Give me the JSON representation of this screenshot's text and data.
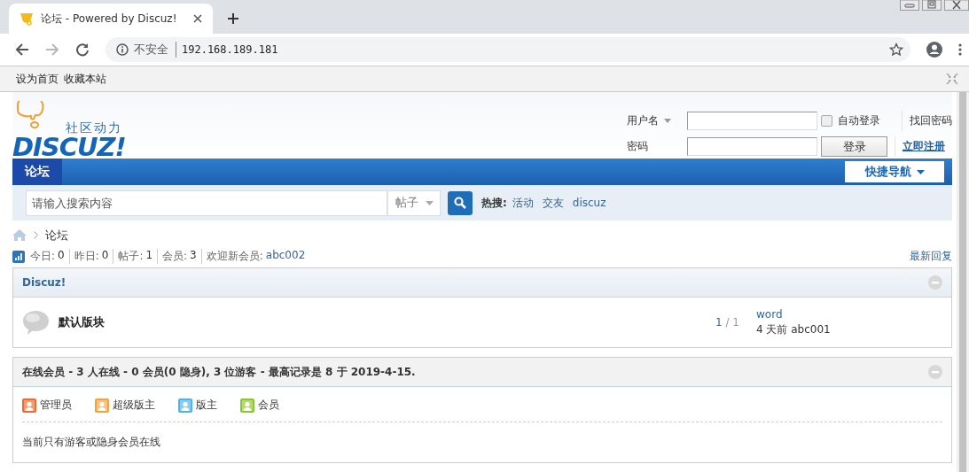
{
  "browser": {
    "tab": {
      "title": "论坛 - Powered by Discuz!"
    },
    "forward_disabled": true,
    "address": {
      "security": "不安全",
      "url": "192.168.189.181"
    },
    "bookmarks": [
      "设为首页",
      "收藏本站"
    ]
  },
  "header": {
    "logo": {
      "tagline": "社区动力",
      "wordmark": "DISCUZ!"
    },
    "login": {
      "username_label": "用户名",
      "password_label": "密码",
      "remember": {
        "label": "自动登录",
        "checked": false
      },
      "login_button": "登录",
      "forgot": "找回密码",
      "register": "立即注册"
    }
  },
  "navbar": {
    "items": [
      {
        "label": "论坛",
        "selected": true
      }
    ],
    "quick_nav": "快捷导航"
  },
  "search": {
    "placeholder": "请输入搜索内容",
    "scope": "帖子",
    "hot_label": "热搜:",
    "hot": [
      "活动",
      "交友",
      "discuz"
    ]
  },
  "breadcrumb": [
    "论坛"
  ],
  "stats": [
    {
      "label": "今日:",
      "value": "0",
      "kind": "count"
    },
    {
      "label": "昨日:",
      "value": "0",
      "kind": "count"
    },
    {
      "label": "帖子:",
      "value": "1",
      "kind": "count"
    },
    {
      "label": "会员:",
      "value": "3",
      "kind": "count"
    },
    {
      "label": "欢迎新会员:",
      "value": "abc002",
      "kind": "link"
    }
  ],
  "latest_replies": "最新回复",
  "categories": [
    {
      "title": "Discuz!",
      "forums": [
        {
          "name": "默认版块",
          "threads": "1",
          "posts": "/ 1",
          "last_post": {
            "subject": "word",
            "meta": "4 天前 abc001"
          }
        }
      ]
    }
  ],
  "online": {
    "title": "在线会员 - 3 人在线 - 0 会员(0 隐身), 3 位游客 - 最高记录是 8 于 2019-4-15.",
    "legend": [
      {
        "label": "管理员",
        "color": "#f06a2c"
      },
      {
        "label": "超级版主",
        "color": "#f4a23e"
      },
      {
        "label": "版主",
        "color": "#4cb4e6"
      },
      {
        "label": "会员",
        "color": "#8cc62c"
      }
    ],
    "message": "当前只有游客或隐身会员在线"
  }
}
